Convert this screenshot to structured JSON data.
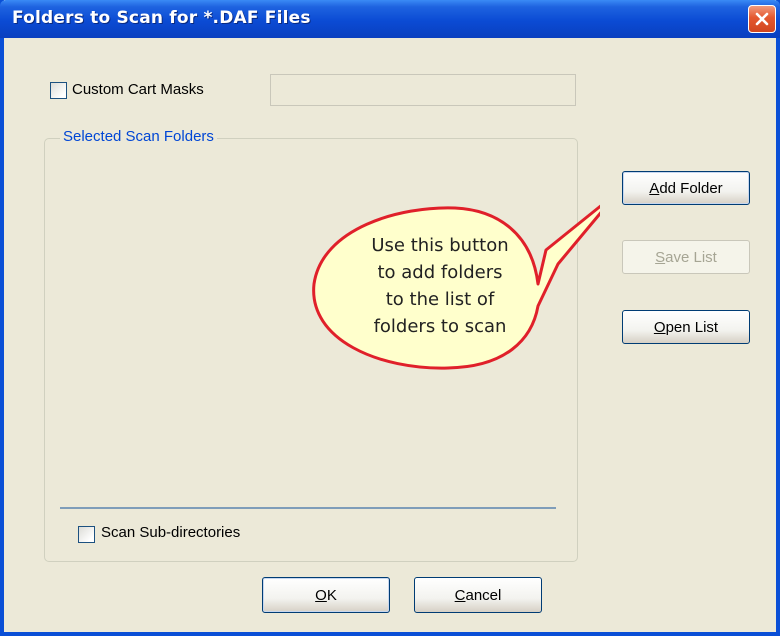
{
  "window": {
    "title": "Folders to Scan for *.DAF Files"
  },
  "custom_cart_masks": {
    "label": "Custom Cart Masks",
    "checked": false,
    "value": ""
  },
  "scan_folders_group": {
    "legend": "Selected Scan Folders",
    "items": []
  },
  "scan_subdirectories": {
    "label": "Scan Sub-directories",
    "checked": false
  },
  "buttons": {
    "add_folder": {
      "mnemonic": "A",
      "rest": "dd Folder",
      "enabled": true
    },
    "save_list": {
      "mnemonic": "S",
      "rest": "ave List",
      "enabled": false
    },
    "open_list": {
      "mnemonic": "O",
      "rest": "pen List",
      "enabled": true
    },
    "ok": {
      "mnemonic": "O",
      "rest": "K",
      "enabled": true
    },
    "cancel": {
      "mnemonic": "C",
      "rest": "ancel",
      "enabled": true
    }
  },
  "callout": {
    "lines": [
      "Use this button",
      "to add folders",
      "to the list of",
      "folders to scan"
    ],
    "fill_color": "#ffffcc",
    "border_color": "#e0202a"
  },
  "colors": {
    "titlebar": "#0a4fd6",
    "dialog_bg": "#ece9d8",
    "group_legend": "#0046d5"
  }
}
